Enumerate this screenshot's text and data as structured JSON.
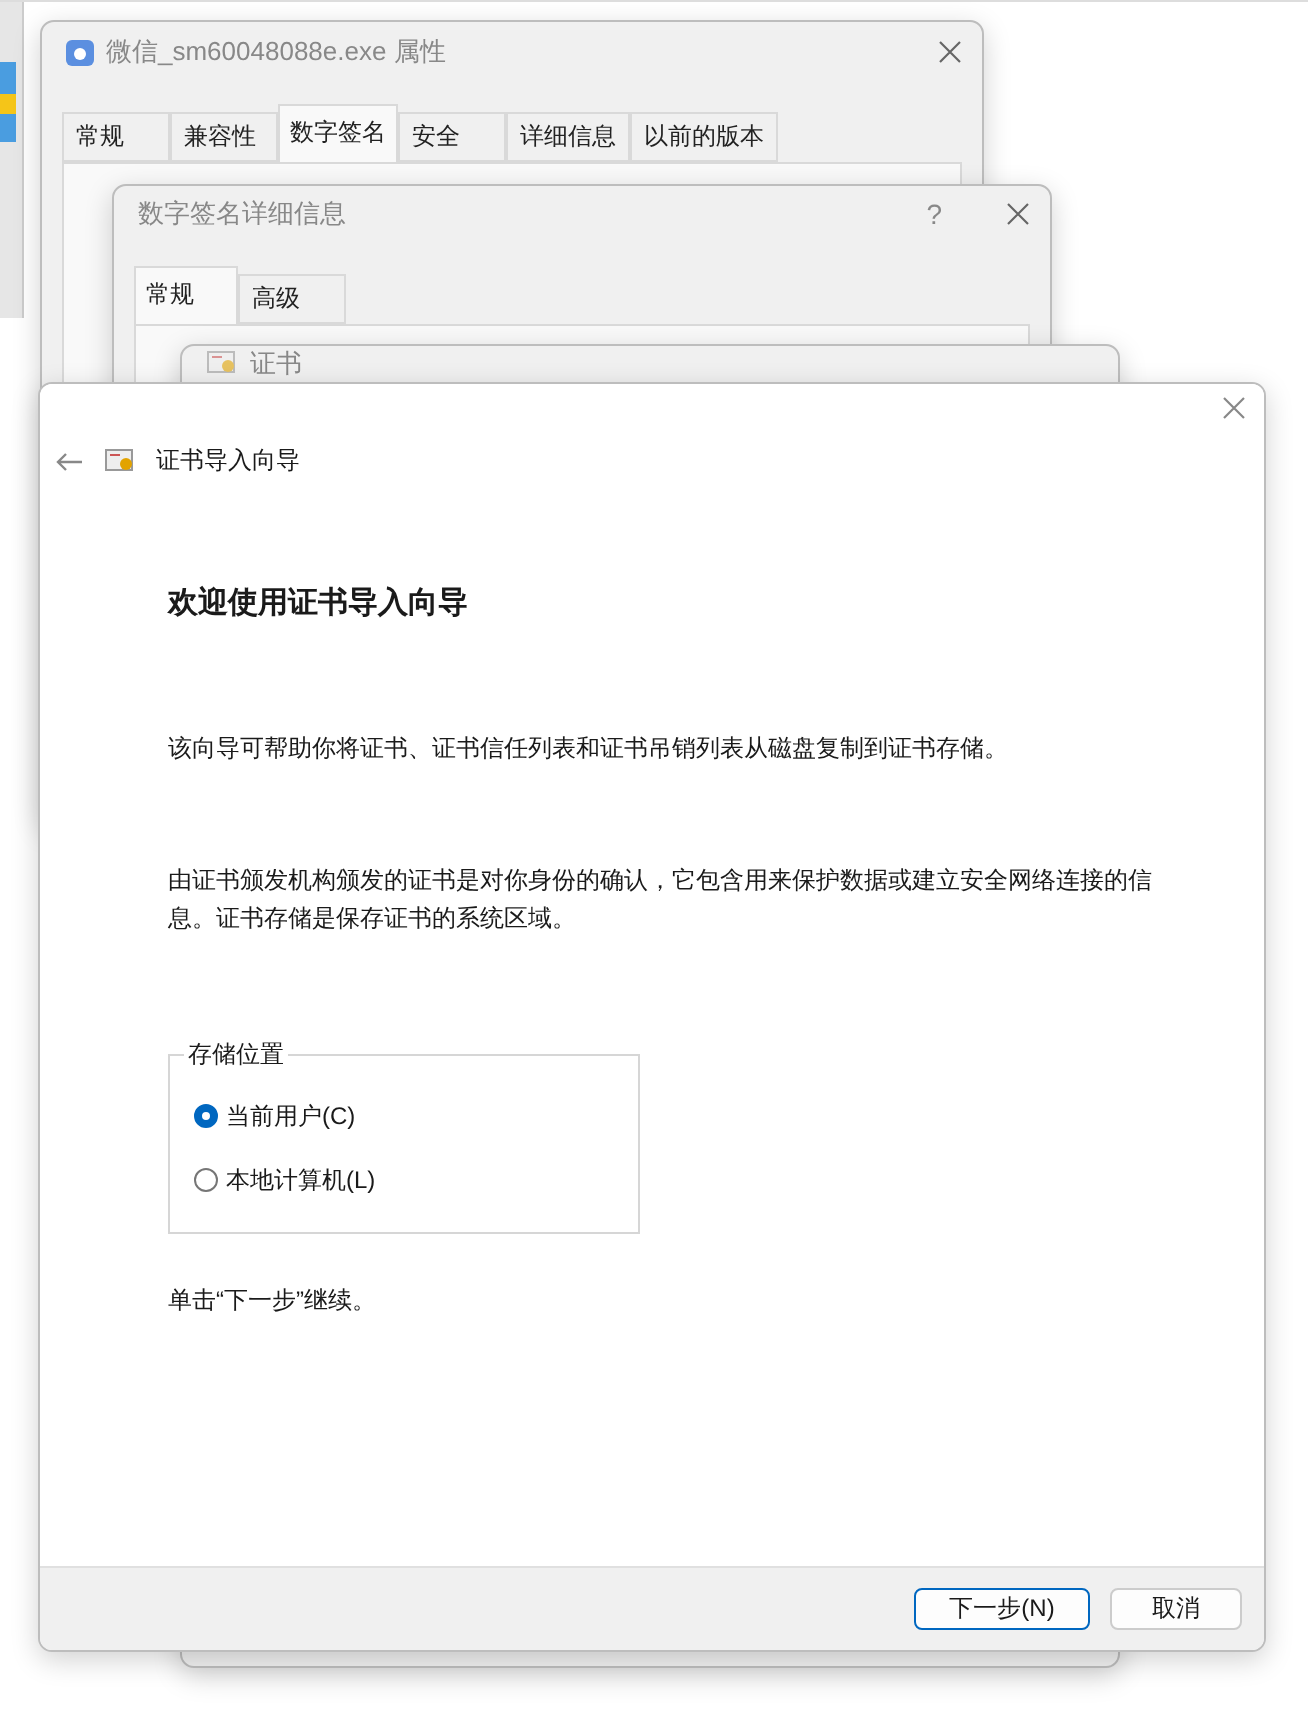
{
  "properties_window": {
    "title": "微信_sm60048088e.exe 属性",
    "tabs": [
      {
        "label": "常规",
        "selected": false
      },
      {
        "label": "兼容性",
        "selected": false
      },
      {
        "label": "数字签名",
        "selected": true
      },
      {
        "label": "安全",
        "selected": false
      },
      {
        "label": "详细信息",
        "selected": false
      },
      {
        "label": "以前的版本",
        "selected": false
      }
    ]
  },
  "signature_details_window": {
    "title": "数字签名详细信息",
    "help": "?",
    "tabs": [
      {
        "label": "常规",
        "selected": true
      },
      {
        "label": "高级",
        "selected": false
      }
    ]
  },
  "certificate_window": {
    "title": "证书"
  },
  "wizard": {
    "title": "证书导入向导",
    "heading": "欢迎使用证书导入向导",
    "paragraphs": [
      "该向导可帮助你将证书、证书信任列表和证书吊销列表从磁盘复制到证书存储。",
      "由证书颁发机构颁发的证书是对你身份的确认，它包含用来保护数据或建立安全网络连接的信息。证书存储是保存证书的系统区域。"
    ],
    "store_location": {
      "legend": "存储位置",
      "options": [
        {
          "label": "当前用户(C)",
          "selected": true
        },
        {
          "label": "本地计算机(L)",
          "selected": false
        }
      ]
    },
    "hint": "单击“下一步”继续。",
    "buttons": [
      {
        "label": "下一步(N)",
        "kind": "primary"
      },
      {
        "label": "取消",
        "kind": "secondary"
      }
    ]
  }
}
